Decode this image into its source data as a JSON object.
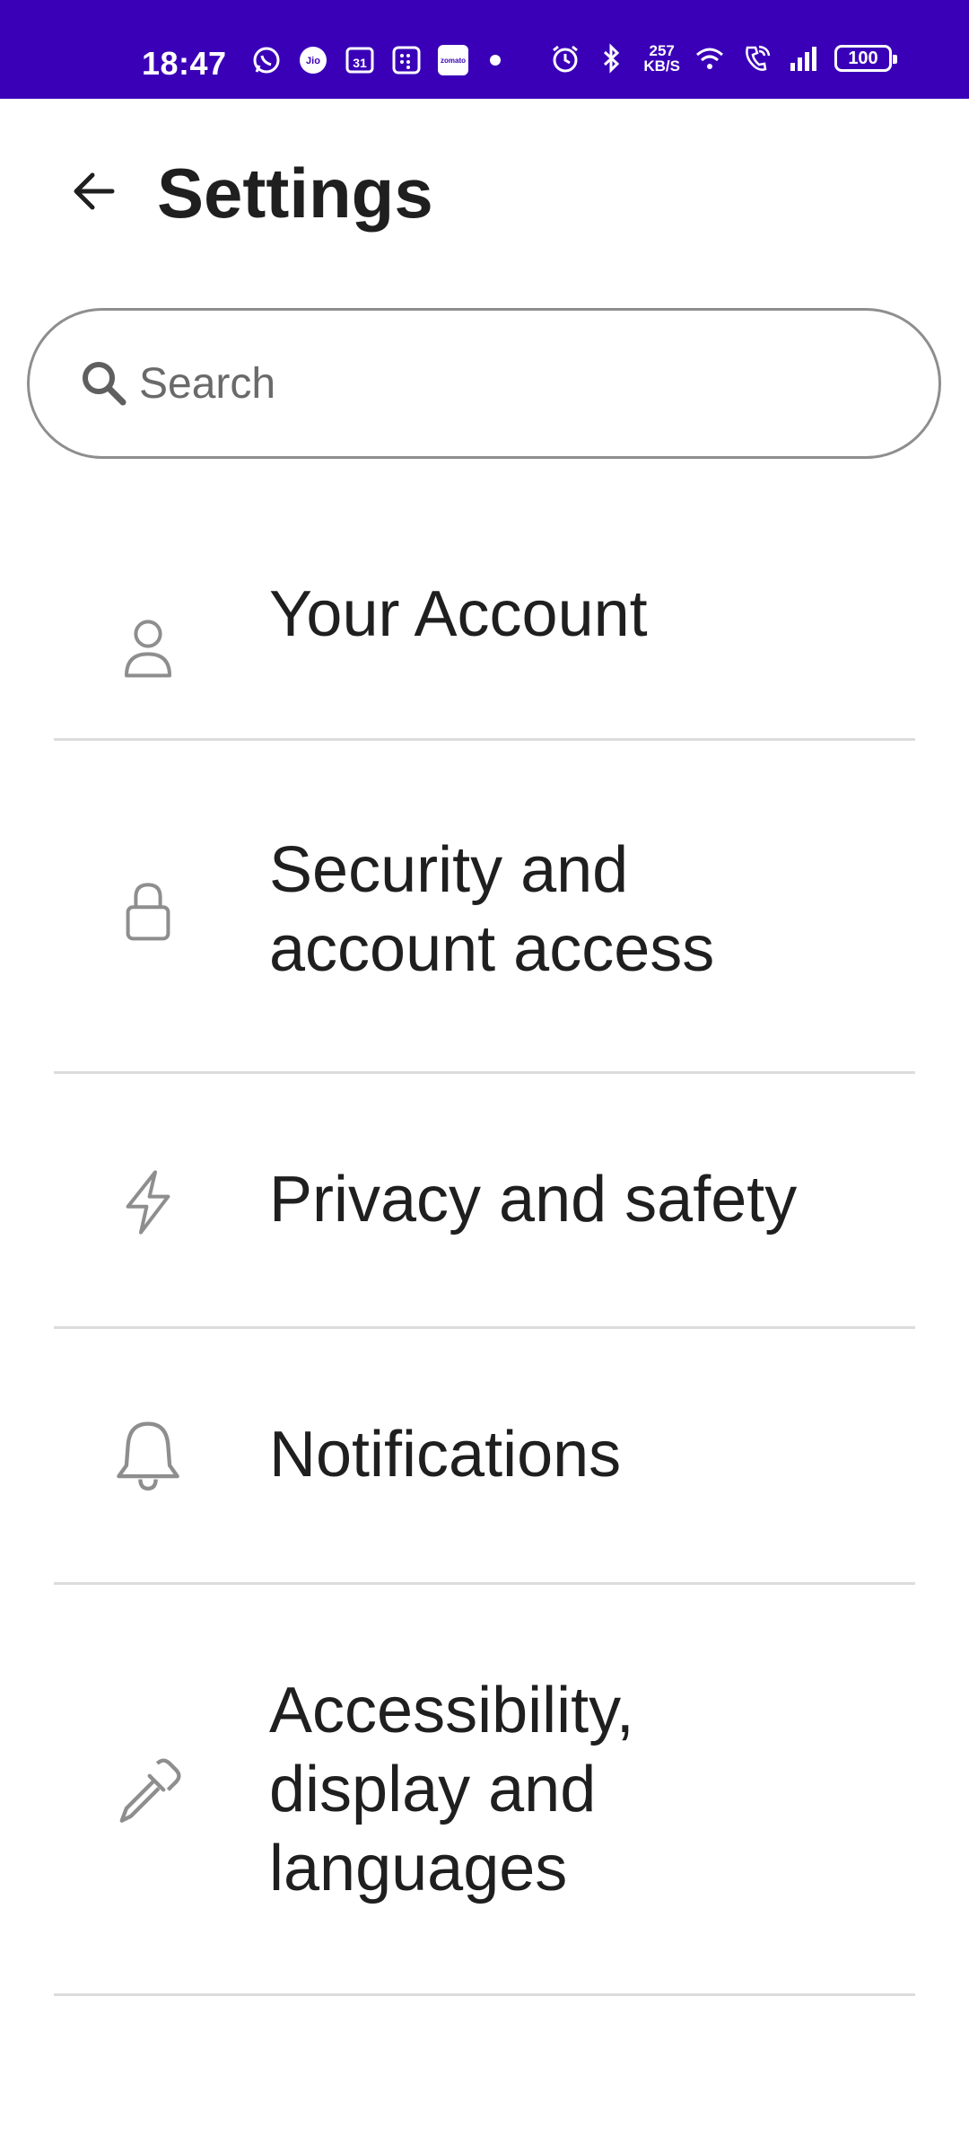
{
  "status_bar": {
    "time": "18:47",
    "speed_value": "257",
    "speed_unit": "KB/S",
    "battery": "100",
    "zomato_label": "zomato",
    "calendar_day": "31",
    "icons": [
      "whatsapp-icon",
      "jio-icon",
      "calendar-icon",
      "grid-app-icon",
      "zomato-icon",
      "dot-icon",
      "alarm-icon",
      "bluetooth-icon",
      "wifi-icon",
      "wifi-call-icon",
      "signal-icon",
      "battery-icon"
    ]
  },
  "header": {
    "title": "Settings",
    "back_icon": "arrow-left-icon"
  },
  "search": {
    "placeholder": "Search",
    "value": ""
  },
  "menu": {
    "items": [
      {
        "label_lines": [
          "Your Account"
        ],
        "icon": "person-icon"
      },
      {
        "label_lines": [
          "Security and",
          "account access"
        ],
        "icon": "lock-icon"
      },
      {
        "label_lines": [
          "Privacy and safety"
        ],
        "icon": "lightning-icon"
      },
      {
        "label_lines": [
          "Notifications"
        ],
        "icon": "bell-icon"
      },
      {
        "label_lines": [
          "Accessibility,",
          "display and",
          "languages"
        ],
        "icon": "eyedropper-icon"
      }
    ]
  },
  "colors": {
    "status_bar_bg": "#3a00b8",
    "text": "#1f1f1f",
    "icon_gray": "#8e8e8e",
    "divider": "#dcdcdc"
  }
}
